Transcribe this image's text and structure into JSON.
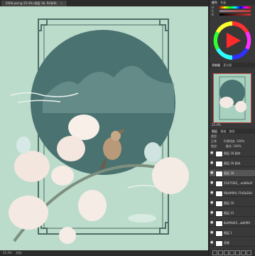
{
  "document": {
    "tab_title": "2000.psd @ 25.4% (图层 18, RGB/8)",
    "close_glyph": "×"
  },
  "status": {
    "zoom": "25.4%",
    "info": "文档:"
  },
  "colors": {
    "canvas_bg": "#bcdccb",
    "circle_fill": "#4a7270",
    "frame_line": "#4d6e66",
    "panel_bg": "#383838",
    "selection_red": "#c74a4a"
  },
  "color_panel": {
    "tabs": [
      "颜色",
      "色板"
    ],
    "bars": [
      {
        "label": "H",
        "icon": "hue-slider-icon"
      },
      {
        "label": "S",
        "icon": "saturation-slider-icon"
      },
      {
        "label": "B",
        "icon": "brightness-slider-icon"
      }
    ]
  },
  "navigator": {
    "tabs": [
      "导航器",
      "直方图"
    ],
    "zoom": "25.4%"
  },
  "layers_panel": {
    "tabs": [
      "图层",
      "通道",
      "路径"
    ],
    "kind": "类型",
    "blend": "正常",
    "opacity_label": "不透明度:",
    "opacity": "100%",
    "lock_label": "锁定:",
    "fill_label": "填充:",
    "fill": "100%",
    "layers": [
      {
        "name": "图层 18 副本",
        "visible": true,
        "selected": false
      },
      {
        "name": "图层 18 副本",
        "visible": true,
        "selected": false
      },
      {
        "name": "图层 18",
        "visible": true,
        "selected": true
      },
      {
        "name": "5547f283_..ed48e2f",
        "visible": true,
        "selected": false
      },
      {
        "name": "98a9f6fd..f7a5b26d",
        "visible": true,
        "selected": false
      },
      {
        "name": "图层 16",
        "visible": true,
        "selected": false
      },
      {
        "name": "图层 15",
        "visible": true,
        "selected": false
      },
      {
        "name": "8a0f9d45...ab6f99",
        "visible": true,
        "selected": false
      },
      {
        "name": "图层 1",
        "visible": true,
        "selected": false
      },
      {
        "name": "背景",
        "visible": true,
        "selected": false
      }
    ],
    "footer_icons": [
      "link-icon",
      "fx-icon",
      "mask-icon",
      "adjustment-icon",
      "folder-icon",
      "new-layer-icon",
      "trash-icon"
    ]
  }
}
